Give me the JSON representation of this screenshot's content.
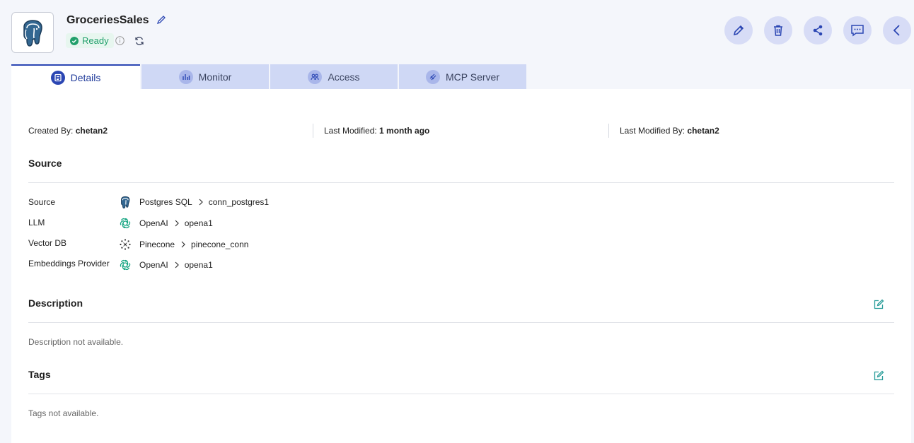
{
  "header": {
    "title": "GroceriesSales",
    "status": "Ready"
  },
  "tabs": [
    {
      "label": "Details",
      "active": true
    },
    {
      "label": "Monitor",
      "active": false
    },
    {
      "label": "Access",
      "active": false
    },
    {
      "label": "MCP Server",
      "active": false
    }
  ],
  "meta": {
    "created_by_label": "Created By:",
    "created_by": "chetan2",
    "last_modified_label": "Last Modified:",
    "last_modified": "1 month ago",
    "last_modified_by_label": "Last Modified By:",
    "last_modified_by": "chetan2"
  },
  "source_section": {
    "title": "Source",
    "rows": [
      {
        "label": "Source",
        "provider": "Postgres SQL",
        "connection": "conn_postgres1",
        "icon": "postgres-icon"
      },
      {
        "label": "LLM",
        "provider": "OpenAI",
        "connection": "opena1",
        "icon": "openai-icon"
      },
      {
        "label": "Vector DB",
        "provider": "Pinecone",
        "connection": "pinecone_conn",
        "icon": "pinecone-icon"
      },
      {
        "label": "Embeddings Provider",
        "provider": "OpenAI",
        "connection": "opena1",
        "icon": "openai-icon"
      }
    ]
  },
  "description_section": {
    "title": "Description",
    "empty_text": "Description not available."
  },
  "tags_section": {
    "title": "Tags",
    "empty_text": "Tags not available."
  },
  "colors": {
    "accent": "#2b46b3",
    "ready_green": "#21a06b",
    "teal_edit": "#2a9d9a",
    "action_bg": "#d7dcf6"
  }
}
